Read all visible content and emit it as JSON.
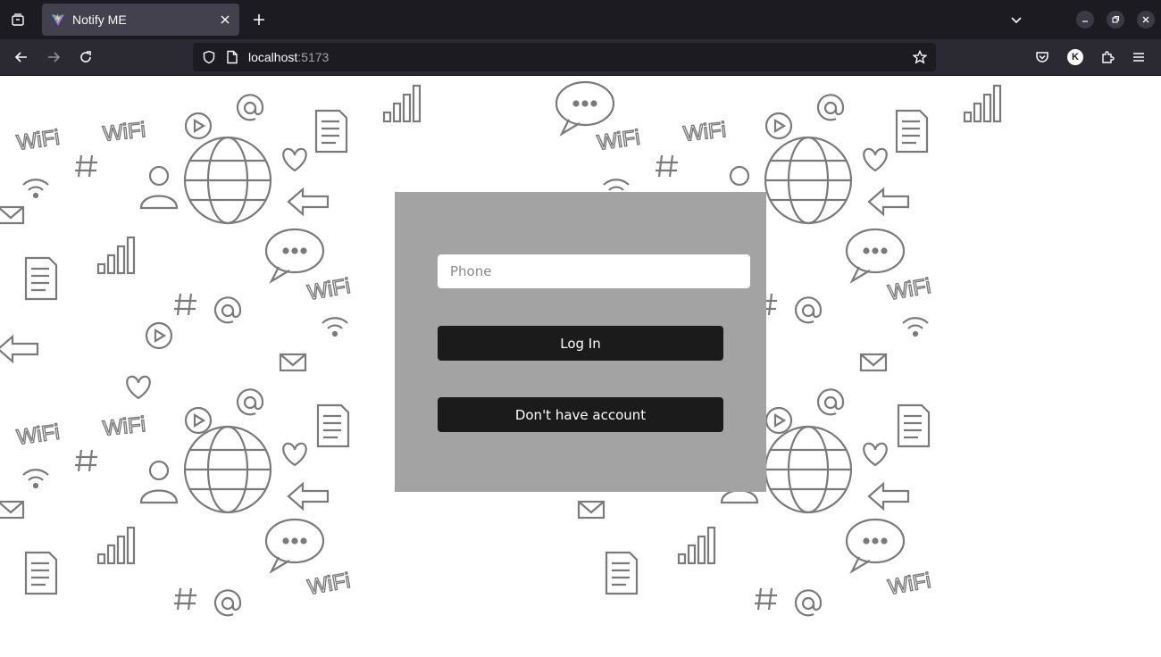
{
  "browser": {
    "tab": {
      "title": "Notify ME",
      "favicon": "vite-logo-icon"
    },
    "url": {
      "host": "localhost",
      "port": ":5173"
    },
    "profile_initial": "K",
    "colors": {
      "tabbar_bg": "#1c1b22",
      "navbar_bg": "#2b2a33",
      "urlbar_bg": "#1c1b22"
    },
    "icons": {
      "tab_overview": "tab-overview-icon",
      "tab_close": "close-icon",
      "new_tab": "plus-icon",
      "tab_list": "chevron-down-icon",
      "minimize": "minimize-icon",
      "restore": "restore-icon",
      "close_window": "close-icon",
      "back": "arrow-left-icon",
      "forward": "arrow-right-icon",
      "reload": "reload-icon",
      "tracking_protection": "shield-icon",
      "page_info": "page-icon",
      "bookmark": "star-icon",
      "pocket": "pocket-icon",
      "extensions": "puzzle-icon",
      "menu": "hamburger-icon"
    }
  },
  "login": {
    "phone_placeholder": "Phone",
    "phone_value": "",
    "login_label": "Log In",
    "signup_label": "Don't have account",
    "colors": {
      "card_bg": "#a3a3a3",
      "button_bg": "#1c1b1b",
      "button_text": "#ffffff"
    }
  },
  "background": {
    "pattern": "doodle-social-media-icons",
    "pattern_text": "WiFi"
  }
}
